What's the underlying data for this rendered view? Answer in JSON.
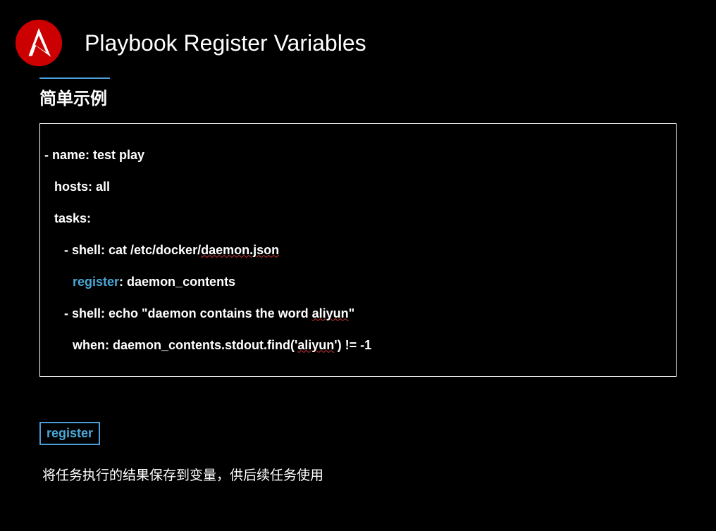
{
  "header": {
    "title": "Playbook Register Variables",
    "subtitle": "简单示例"
  },
  "code": {
    "line1_pre": "- name: test play",
    "line2": "hosts: all",
    "line3": "tasks:",
    "line4_pre": "- shell: cat /etc/docker/",
    "line4_wavy": "daemon.json",
    "line5_kw": "register",
    "line5_rest": ": daemon_contents",
    "line6_pre": "- shell: echo \"daemon contains the word ",
    "line6_wavy": "aliyun",
    "line6_post": "\"",
    "line7_pre": "when: daemon_contents.stdout.find('",
    "line7_wavy": "aliyun",
    "line7_post": "') != -1"
  },
  "tag": {
    "label": "register"
  },
  "description": "将任务执行的结果保存到变量，供后续任务使用"
}
